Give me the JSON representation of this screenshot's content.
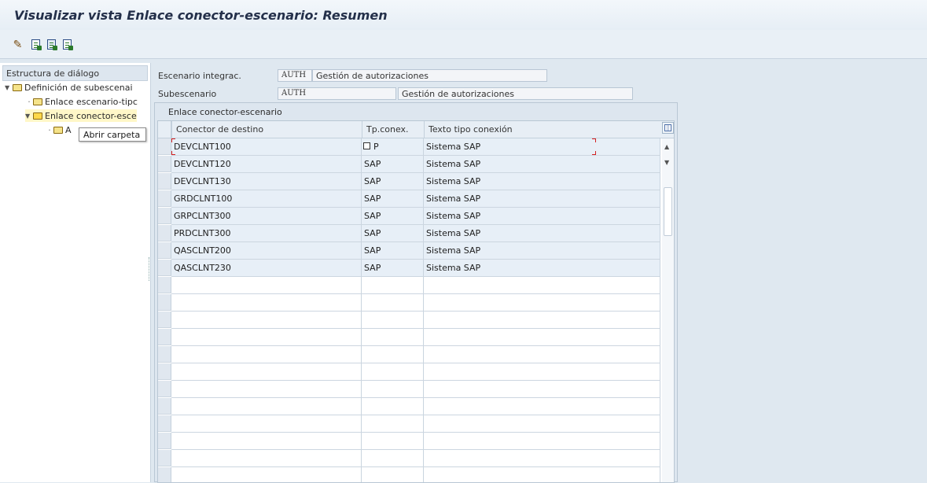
{
  "window": {
    "title": "Visualizar vista Enlace conector-escenario: Resumen"
  },
  "toolbar": {
    "icons": [
      "change-glasses-icon",
      "document-icon",
      "document-icon",
      "document-icon"
    ]
  },
  "tree": {
    "header": "Estructura de diálogo",
    "items": [
      {
        "label": "Definición de subescenai",
        "level": 0,
        "expanded": true
      },
      {
        "label": "Enlace escenario-tipc",
        "level": 1,
        "expanded": false
      },
      {
        "label": "Enlace conector-esce",
        "level": 1,
        "expanded": true,
        "selected": true
      },
      {
        "label": "A",
        "level": 2,
        "expanded": false
      }
    ],
    "tooltip": "Abrir carpeta"
  },
  "header_fields": {
    "escenario": {
      "label": "Escenario integrac.",
      "code": "AUTH",
      "text": "Gestión de autorizaciones"
    },
    "subescenario": {
      "label": "Subescenario",
      "code": "AUTH",
      "text": "Gestión de autorizaciones"
    }
  },
  "table": {
    "title": "Enlace conector-escenario",
    "columns": [
      "Conector de destino",
      "Tp.conex.",
      "Texto tipo conexión"
    ],
    "rows": [
      {
        "conector": "DEVCLNT100",
        "tipo": "P",
        "texto": "Sistema SAP"
      },
      {
        "conector": "DEVCLNT120",
        "tipo": "SAP",
        "texto": "Sistema SAP"
      },
      {
        "conector": "DEVCLNT130",
        "tipo": "SAP",
        "texto": "Sistema SAP"
      },
      {
        "conector": "GRDCLNT100",
        "tipo": "SAP",
        "texto": "Sistema SAP"
      },
      {
        "conector": "GRPCLNT300",
        "tipo": "SAP",
        "texto": "Sistema SAP"
      },
      {
        "conector": "PRDCLNT300",
        "tipo": "SAP",
        "texto": "Sistema SAP"
      },
      {
        "conector": "QASCLNT200",
        "tipo": "SAP",
        "texto": "Sistema SAP"
      },
      {
        "conector": "QASCLNT230",
        "tipo": "SAP",
        "texto": "Sistema SAP"
      }
    ],
    "empty_rows": 12
  }
}
